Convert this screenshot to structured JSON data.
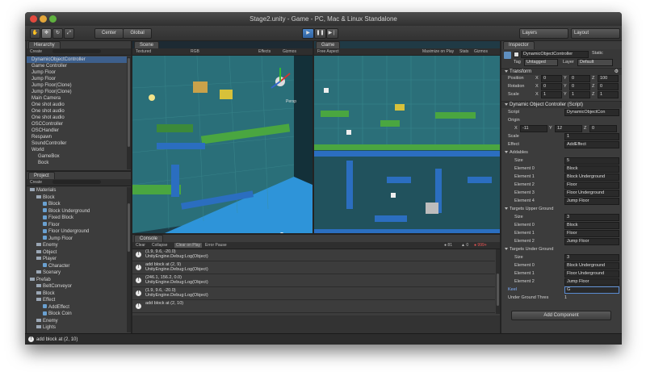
{
  "window": {
    "title": "Stage2.unity - Game - PC, Mac & Linux Standalone"
  },
  "toolbar": {
    "center_label": "Center",
    "global_label": "Global",
    "layers_label": "Layers",
    "layout_label": "Layout"
  },
  "hierarchy": {
    "tab": "Hierarchy",
    "create": "Create",
    "items": [
      {
        "label": "DynamicObjectController",
        "selected": true
      },
      {
        "label": "Game Controller"
      },
      {
        "label": "Jump Floor"
      },
      {
        "label": "Jump Floor"
      },
      {
        "label": "Jump Floor(Clone)"
      },
      {
        "label": "Jump Floor(Clone)"
      },
      {
        "label": "Main Camera"
      },
      {
        "label": "One shot audio"
      },
      {
        "label": "One shot audio"
      },
      {
        "label": "One shot audio"
      },
      {
        "label": "OSCController"
      },
      {
        "label": "OSCHandler"
      },
      {
        "label": "Respawn"
      },
      {
        "label": "SoundController"
      },
      {
        "label": "World"
      },
      {
        "label": "GameBox"
      },
      {
        "label": "Bock"
      }
    ]
  },
  "project": {
    "tab": "Project",
    "create": "Create",
    "items": [
      {
        "label": "Materials",
        "depth": 0,
        "kind": "folder"
      },
      {
        "label": "Block",
        "depth": 1,
        "kind": "folder"
      },
      {
        "label": "Block",
        "depth": 2,
        "kind": "asset"
      },
      {
        "label": "Block Underground",
        "depth": 2,
        "kind": "asset"
      },
      {
        "label": "Fixed Block",
        "depth": 2,
        "kind": "asset"
      },
      {
        "label": "Floor",
        "depth": 2,
        "kind": "asset"
      },
      {
        "label": "Floor Underground",
        "depth": 2,
        "kind": "asset"
      },
      {
        "label": "Jump Floor",
        "depth": 2,
        "kind": "asset"
      },
      {
        "label": "Enemy",
        "depth": 1,
        "kind": "folder"
      },
      {
        "label": "Object",
        "depth": 1,
        "kind": "folder"
      },
      {
        "label": "Player",
        "depth": 1,
        "kind": "folder"
      },
      {
        "label": "Character",
        "depth": 2,
        "kind": "asset"
      },
      {
        "label": "Scenary",
        "depth": 1,
        "kind": "folder"
      },
      {
        "label": "Prefab",
        "depth": 0,
        "kind": "folder"
      },
      {
        "label": "BeltConveyor",
        "depth": 1,
        "kind": "folder"
      },
      {
        "label": "Block",
        "depth": 1,
        "kind": "folder"
      },
      {
        "label": "Effect",
        "depth": 1,
        "kind": "folder"
      },
      {
        "label": "AddEffect",
        "depth": 2,
        "kind": "asset"
      },
      {
        "label": "Block Coin",
        "depth": 2,
        "kind": "asset"
      },
      {
        "label": "Enemy",
        "depth": 1,
        "kind": "folder"
      },
      {
        "label": "Lights",
        "depth": 1,
        "kind": "folder"
      }
    ]
  },
  "scene": {
    "tab": "Scene",
    "textured": "Textured",
    "rgb": "RGB",
    "effects": "Effects",
    "gizmos": "Gizmos",
    "persp": "Persp"
  },
  "game": {
    "tab": "Game",
    "aspect": "Free Aspect",
    "maximize": "Maximize on Play",
    "stats": "Stats",
    "gizmos": "Gizmos"
  },
  "console": {
    "tab": "Console",
    "buttons": [
      "Clear",
      "Collapse",
      "Clear on Play",
      "Error Pause"
    ],
    "counts": {
      "info": "81",
      "warn": "0",
      "error": "999+"
    },
    "lines": [
      {
        "main": "(1.9, 9.6, -20.0)",
        "sub": "UnityEngine.Debug:Log(Object)"
      },
      {
        "main": "add block at (2, 9)",
        "sub": "UnityEngine.Debug:Log(Object)"
      },
      {
        "main": "(246.1, 156.2, 0.0)",
        "sub": "UnityEngine.Debug:Log(Object)"
      },
      {
        "main": "(1.9, 9.6, -20.0)",
        "sub": "UnityEngine.Debug:Log(Object)"
      },
      {
        "main": "add block at (2, 10)",
        "sub": ""
      }
    ]
  },
  "status": {
    "text": "add block at (2, 10)"
  },
  "inspector": {
    "tab": "Inspector",
    "object_name": "DynamicObjectController",
    "static": "Static",
    "tag_label": "Tag",
    "tag_value": "Untagged",
    "layer_label": "Layer",
    "layer_value": "Default",
    "transform": {
      "title": "Transform",
      "position": {
        "label": "Position",
        "x": "0",
        "y": "0",
        "z": "100"
      },
      "rotation": {
        "label": "Rotation",
        "x": "0",
        "y": "0",
        "z": "0"
      },
      "scale": {
        "label": "Scale",
        "x": "1",
        "y": "1",
        "z": "1"
      }
    },
    "component": {
      "title": "Dynamic Object Controller (Script)",
      "script_label": "Script",
      "script_value": "DynamicObjectCon",
      "origin_label": "Origin",
      "origin": {
        "x": "-11",
        "y": "12",
        "z": "0"
      },
      "scale_label": "Scale",
      "scale_value": "1",
      "effect_label": "Effect",
      "effect_value": "AddEffect"
    },
    "addables": {
      "title": "Addables",
      "size": "5",
      "elements": [
        "Block",
        "Block Underground",
        "Floor",
        "Floor Underground",
        "Jump Floor"
      ]
    },
    "targets_upper": {
      "title": "Targets Upper Ground",
      "size": "3",
      "elements": [
        "Block",
        "Floor",
        "Jump Floor"
      ]
    },
    "targets_under": {
      "title": "Targets Under Ground",
      "size": "3",
      "elements": [
        "Block Underground",
        "Floor Underground",
        "Jump Floor"
      ]
    },
    "size_label": "Size",
    "element_prefix": "Element",
    "keel_label": "Keel",
    "keel_value": "G",
    "under_ground_label": "Under Ground Thres",
    "under_ground_value": "1",
    "add_component": "Add Component"
  }
}
